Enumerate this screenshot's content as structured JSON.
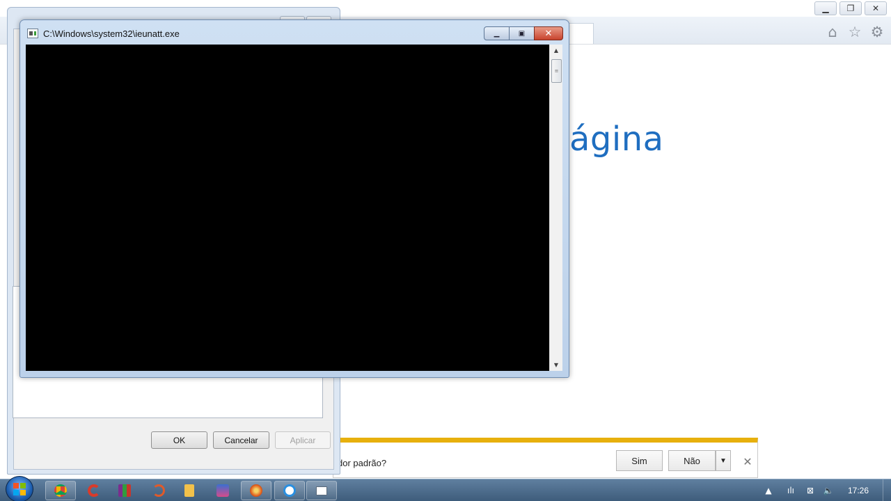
{
  "ie": {
    "page_heading": "ágina",
    "notification": {
      "question": "dor padrão?",
      "yes_label": "Sim",
      "no_label": "Não",
      "dropdown_icon": "chevron-down-icon",
      "close_icon": "close-icon",
      "accent_color": "#e7b00d"
    },
    "toolbar_icons": [
      "home-icon",
      "favorites-star-icon",
      "settings-gear-icon"
    ]
  },
  "options_dialog": {
    "ok_label": "OK",
    "cancel_label": "Cancelar",
    "apply_label": "Aplicar"
  },
  "console": {
    "title": "C:\\Windows\\system32\\ieunatt.exe",
    "background_color": "#000000"
  },
  "taskbar": {
    "pinned_apps": [
      "chrome-icon",
      "ccleaner-icon",
      "winrar-icon",
      "search-tool-icon",
      "media-player-icon",
      "game-icon",
      "firefox-like-icon",
      "internet-explorer-icon",
      "console-app-icon"
    ],
    "clock": "17:26",
    "tray_icons": [
      "show-hidden-icons-icon",
      "signal-icon",
      "network-error-icon",
      "volume-icon"
    ]
  }
}
